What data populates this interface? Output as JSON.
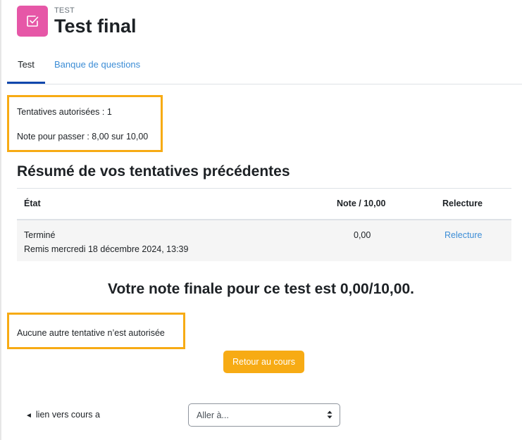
{
  "header": {
    "module_label": "TEST",
    "title": "Test final",
    "icon": "quiz-checkbox-icon",
    "icon_bg": "#e657a7"
  },
  "tabs": [
    {
      "label": "Test",
      "active": true
    },
    {
      "label": "Banque de questions",
      "active": false
    }
  ],
  "info": {
    "attempts_allowed": "Tentatives autorisées : 1",
    "pass_grade": "Note pour passer : 8,00 sur 10,00"
  },
  "summary": {
    "title": "Résumé de vos tentatives précédentes",
    "columns": [
      "État",
      "Note / 10,00",
      "Relecture"
    ],
    "rows": [
      {
        "state": "Terminé",
        "submitted": "Remis mercredi 18 décembre 2024, 13:39",
        "grade": "0,00",
        "review": "Relecture"
      }
    ]
  },
  "final_grade": "Votre note finale pour ce test est 0,00/10,00.",
  "no_more_attempts": "Aucune autre tentative n’est autorisée",
  "back_button": "Retour au cours",
  "prev_activity_link": "lien vers cours a",
  "jump_to": {
    "selected": "Aller à..."
  },
  "colors": {
    "highlight": "#f7ab14",
    "link": "#3c8dd6",
    "active_tab": "#0f47ad",
    "button": "#f7ab14"
  }
}
